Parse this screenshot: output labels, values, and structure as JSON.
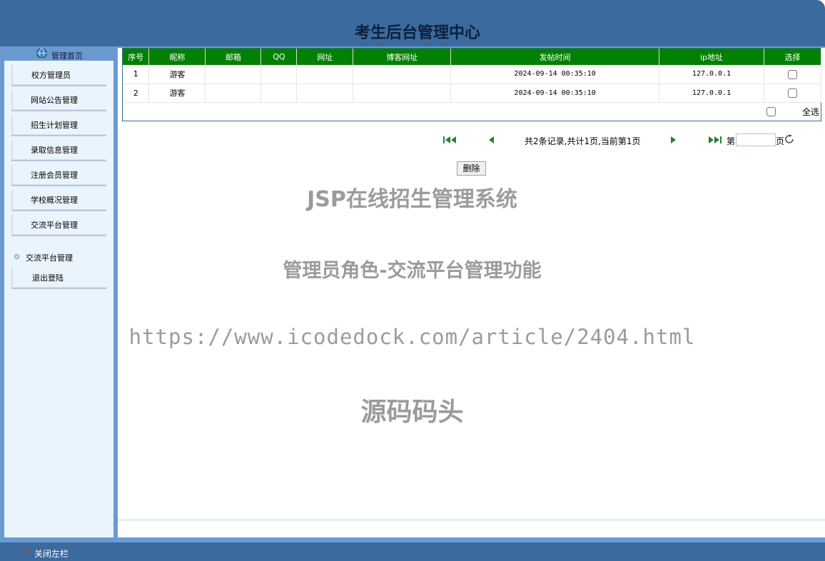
{
  "header": {
    "title": "考生后台管理中心"
  },
  "sidebar": {
    "home_label": "管理首页",
    "items": [
      {
        "label": "校方管理员"
      },
      {
        "label": "网站公告管理"
      },
      {
        "label": "招生计划管理"
      },
      {
        "label": "录取信息管理"
      },
      {
        "label": "注册会员管理"
      },
      {
        "label": "学校概况管理"
      },
      {
        "label": "交流平台管理"
      }
    ],
    "sub_item": "交流平台管理",
    "logout": "退出登陆"
  },
  "table": {
    "columns": [
      "序号",
      "昵称",
      "邮箱",
      "QQ",
      "网址",
      "博客网址",
      "发帖时间",
      "ip地址",
      "选择"
    ],
    "rows": [
      {
        "no": "1",
        "nickname": "游客",
        "email": "",
        "qq": "",
        "site": "",
        "blog": "",
        "time": "2024-09-14 00:35:10",
        "ip": "127.0.0.1"
      },
      {
        "no": "2",
        "nickname": "游客",
        "email": "",
        "qq": "",
        "site": "",
        "blog": "",
        "time": "2024-09-14 00:35:10",
        "ip": "127.0.0.1"
      }
    ],
    "select_all": "全选"
  },
  "pager": {
    "summary": "共2条记录,共计1页,当前第1页",
    "di": "第",
    "ye": "页",
    "page_input": ""
  },
  "actions": {
    "delete": "删除"
  },
  "watermark": {
    "line1": "JSP在线招生管理系统",
    "line2": "管理员角色-交流平台管理功能",
    "line3": "https://www.icodedock.com/article/2404.html",
    "line4": "源码码头"
  },
  "footer": {
    "close_left": "关闭左栏"
  },
  "colors": {
    "header": "#3a6a9e",
    "table_header": "#018001",
    "sidebar": "#eaf4fd"
  }
}
